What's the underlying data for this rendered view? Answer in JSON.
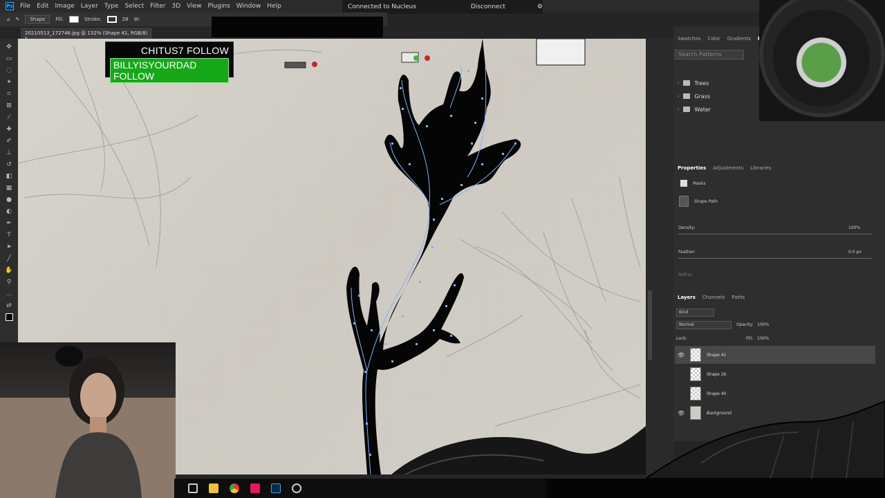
{
  "menu": {
    "app_icon": "Ps",
    "items": [
      "File",
      "Edit",
      "Image",
      "Layer",
      "Type",
      "Select",
      "Filter",
      "3D",
      "View",
      "Plugins",
      "Window",
      "Help"
    ]
  },
  "nucleus": {
    "status": "Connected to Nucleus",
    "disconnect_label": "Disconnect"
  },
  "options": {
    "tool_mode": "Shape",
    "fill_label": "Fill:",
    "stroke_label": "Stroke:",
    "stroke_width": "28",
    "width_label": "W:"
  },
  "document": {
    "tab_title": "20210513_172746.jpg @ 132% (Shape 41, RGB/8) *"
  },
  "overlay": {
    "line1": "CHITUS7  FOLLOW",
    "line2": "BILLYISYOURDAD  FOLLOW"
  },
  "patterns_panel": {
    "tabs": [
      "Swatches",
      "Color",
      "Gradients",
      "Pa"
    ],
    "search_placeholder": "Search Patterns",
    "folders": [
      "Trees",
      "Grass",
      "Water"
    ]
  },
  "properties_panel": {
    "tabs": [
      "Properties",
      "Adjustments",
      "Libraries"
    ],
    "section": "Masks",
    "item": "Shape Path",
    "density_label": "Density:",
    "density_value": "100%",
    "feather_label": "Feather:",
    "feather_value": "0.0 px",
    "refine_label": "Refine:"
  },
  "layers_panel": {
    "tabs": [
      "Layers",
      "Channels",
      "Paths"
    ],
    "filter": "Kind",
    "blend_mode": "Normal",
    "opacity_label": "Opacity:",
    "opacity_value": "100%",
    "lock_label": "Lock:",
    "fill_label": "Fill:",
    "fill_value": "100%",
    "layers": [
      {
        "name": "Shape 41",
        "visible": true,
        "selected": true
      },
      {
        "name": "Shape 26",
        "visible": false,
        "selected": false
      },
      {
        "name": "Shape 40",
        "visible": false,
        "selected": false
      },
      {
        "name": "Background",
        "visible": true,
        "selected": false
      }
    ]
  },
  "colors": {
    "accent": "#31a8ff",
    "follow_green": "#17a81a",
    "path_blue": "#7fb2ff"
  }
}
